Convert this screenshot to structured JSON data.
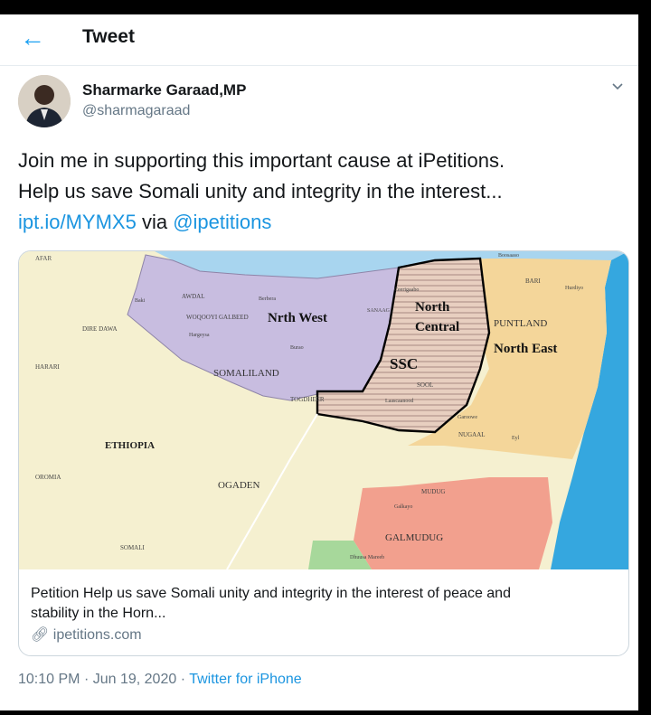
{
  "header": {
    "back_icon": "arrow-left-icon",
    "title": "Tweet"
  },
  "author": {
    "name": "Sharmarke Garaad,MP",
    "handle": "@sharmagaraad"
  },
  "tweet": {
    "text_line1": "Join me in supporting this important cause at iPetitions.",
    "text_line2": "Help us save Somali unity and integrity in the interest...",
    "link": "ipt.io/MYMX5",
    "via": "via",
    "mention": "@ipetitions"
  },
  "card": {
    "description_line1": "Petition Help us save Somali unity and integrity in the interest of peace and",
    "description_line2": "stability in the Horn...",
    "domain": "ipetitions.com",
    "map_labels": {
      "afar": "AFAR",
      "awdal": "AWDAL",
      "baki": "Baki",
      "woqooyi_galbeed": "WOQOOYI GALBEED",
      "hargeysa": "Hargeysa",
      "berbera": "Berbera",
      "burao": "Burao",
      "nrth_west": "Nrth West",
      "sanaag": "SANAAG",
      "ceerigaabo": "Ceerigaabo",
      "north_central": "North Central",
      "bosaso": "Boosaaso",
      "bari": "BARI",
      "hurdiyo": "Hurdiyo",
      "puntland": "PUNTLAND",
      "north_east": "North East",
      "dire_dawa": "DIRE DAWA",
      "harari": "HARARI",
      "somaliland": "SOMALILAND",
      "ssc": "SSC",
      "sool": "SOOL",
      "togdheer": "TOGDHEER",
      "laascaanood": "Laascaanood",
      "garoowe": "Garoowe",
      "nugaal": "NUGAAL",
      "eyl": "Eyl",
      "ethiopia": "ETHIOPIA",
      "oromia": "OROMIA",
      "ogaden": "OGADEN",
      "mudug": "MUDUG",
      "galkayo": "Galkayo",
      "galmudug": "GALMUDUG",
      "somali": "SOMALI",
      "dhuusa_mareeb": "Dhuusa Mareeb"
    }
  },
  "meta": {
    "time": "10:10 PM",
    "date": "Jun 19, 2020",
    "source": "Twitter for iPhone"
  }
}
